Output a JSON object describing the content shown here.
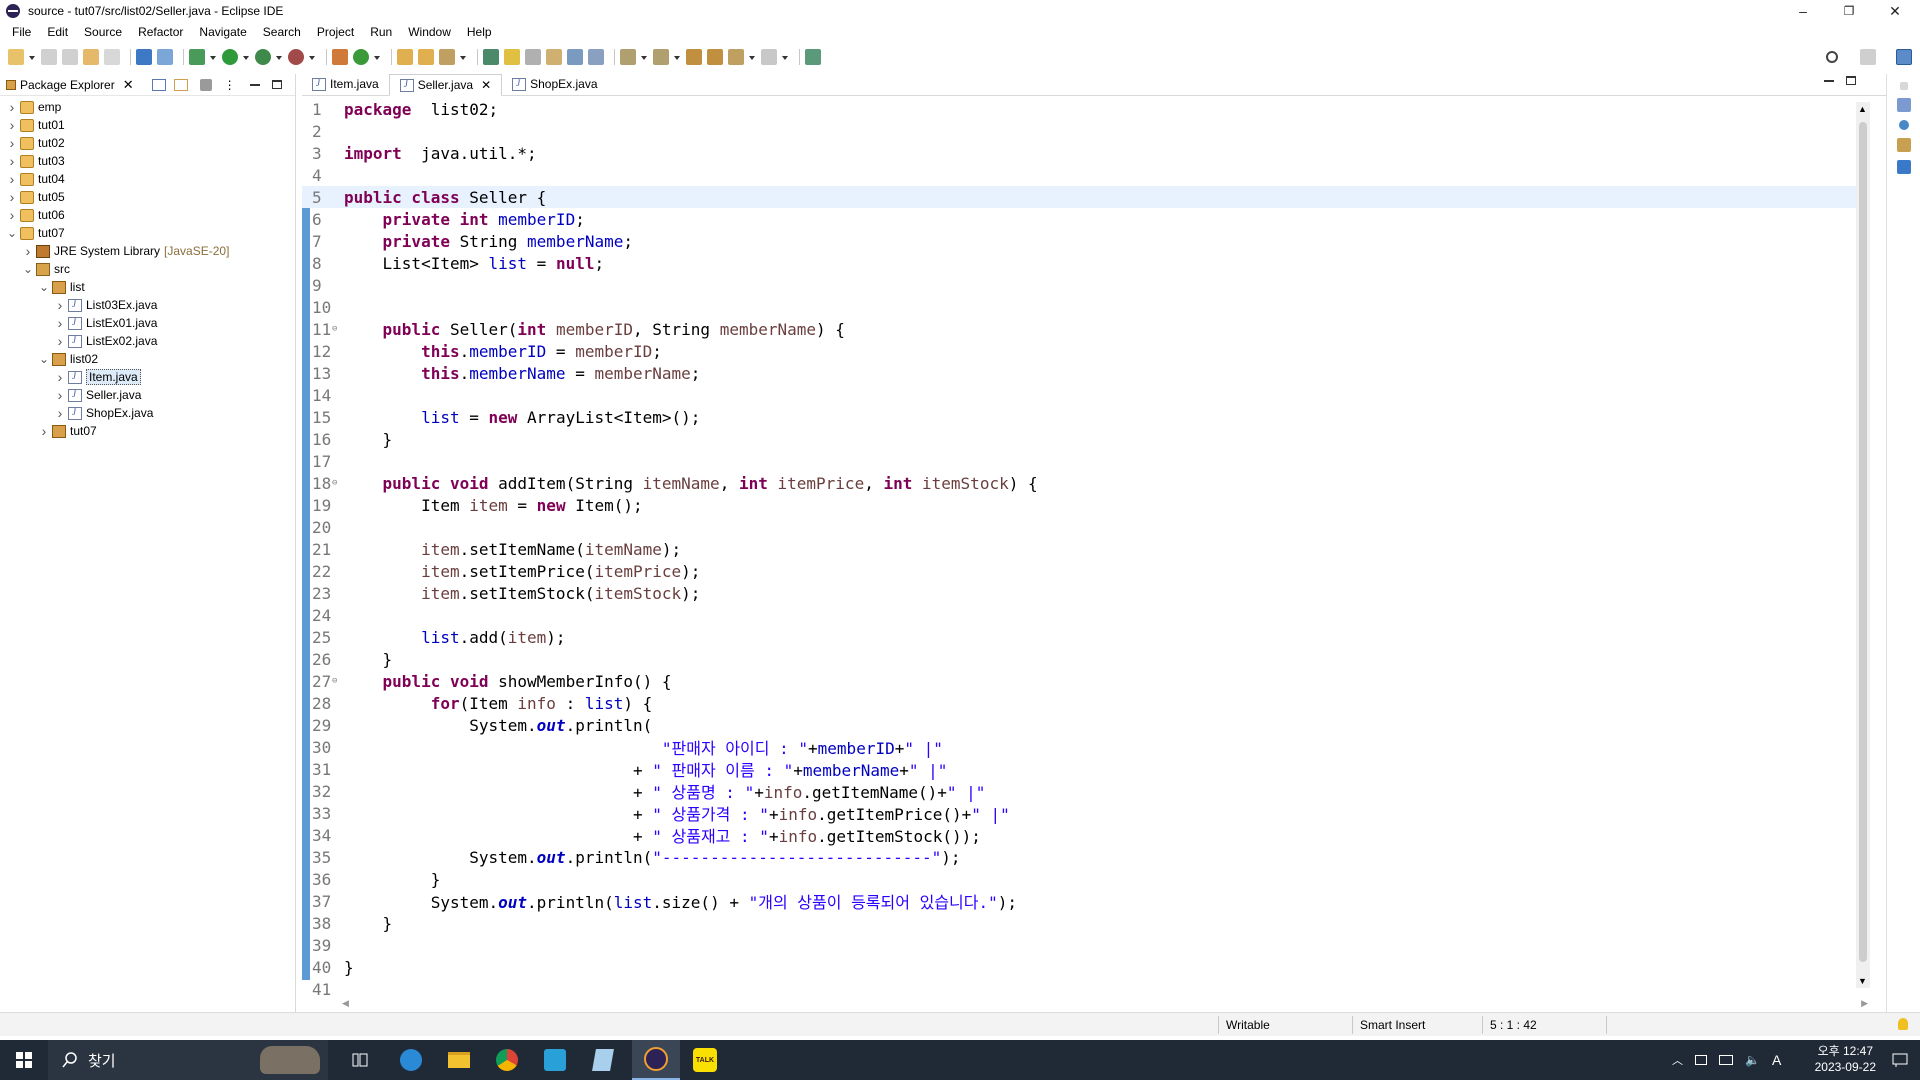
{
  "window": {
    "title": "source - tut07/src/list02/Seller.java - Eclipse IDE",
    "minimize": "–",
    "maximize": "❐",
    "close": "✕"
  },
  "menu": [
    "File",
    "Edit",
    "Source",
    "Refactor",
    "Navigate",
    "Search",
    "Project",
    "Run",
    "Window",
    "Help"
  ],
  "package_explorer": {
    "tab_label": "Package Explorer",
    "tree": [
      {
        "label": "emp",
        "depth": 0,
        "expanded": false,
        "icon": "project-icon"
      },
      {
        "label": "tut01",
        "depth": 0,
        "expanded": false,
        "icon": "project-icon"
      },
      {
        "label": "tut02",
        "depth": 0,
        "expanded": false,
        "icon": "project-icon"
      },
      {
        "label": "tut03",
        "depth": 0,
        "expanded": false,
        "icon": "project-icon"
      },
      {
        "label": "tut04",
        "depth": 0,
        "expanded": false,
        "icon": "project-icon"
      },
      {
        "label": "tut05",
        "depth": 0,
        "expanded": false,
        "icon": "project-icon"
      },
      {
        "label": "tut06",
        "depth": 0,
        "expanded": false,
        "icon": "project-icon"
      },
      {
        "label": "tut07",
        "depth": 0,
        "expanded": true,
        "icon": "project-icon"
      },
      {
        "label": "JRE System Library",
        "deco": "[JavaSE-20]",
        "depth": 1,
        "expanded": false,
        "icon": "library-icon"
      },
      {
        "label": "src",
        "depth": 1,
        "expanded": true,
        "icon": "source-folder-icon"
      },
      {
        "label": "list",
        "depth": 2,
        "expanded": true,
        "icon": "package-icon"
      },
      {
        "label": "List03Ex.java",
        "depth": 3,
        "expanded": false,
        "icon": "java-file-icon"
      },
      {
        "label": "ListEx01.java",
        "depth": 3,
        "expanded": false,
        "icon": "java-file-icon"
      },
      {
        "label": "ListEx02.java",
        "depth": 3,
        "expanded": false,
        "icon": "java-file-icon"
      },
      {
        "label": "list02",
        "depth": 2,
        "expanded": true,
        "icon": "package-icon"
      },
      {
        "label": "Item.java",
        "depth": 3,
        "expanded": false,
        "icon": "java-file-icon",
        "selected": true
      },
      {
        "label": "Seller.java",
        "depth": 3,
        "expanded": false,
        "icon": "java-file-icon"
      },
      {
        "label": "ShopEx.java",
        "depth": 3,
        "expanded": false,
        "icon": "java-file-icon"
      },
      {
        "label": "tut07",
        "depth": 2,
        "expanded": false,
        "icon": "package-icon"
      }
    ]
  },
  "editor": {
    "tabs": [
      {
        "label": "Item.java",
        "active": false
      },
      {
        "label": "Seller.java",
        "active": true
      },
      {
        "label": "ShopEx.java",
        "active": false
      }
    ],
    "current_line": 5,
    "lines": [
      [
        [
          "k",
          "package"
        ],
        [
          "",
          "  list02;"
        ]
      ],
      [],
      [
        [
          "k",
          "import"
        ],
        [
          "",
          "  java.util.*;"
        ]
      ],
      [],
      [
        [
          "k",
          "public class"
        ],
        [
          "",
          " Seller {"
        ]
      ],
      [
        [
          "",
          "    "
        ],
        [
          "k",
          "private int"
        ],
        [
          "",
          ""
        ],
        [
          "f",
          " memberID"
        ],
        [
          "",
          ";"
        ]
      ],
      [
        [
          "",
          "    "
        ],
        [
          "k",
          "private"
        ],
        [
          "",
          " String "
        ],
        [
          "f",
          "memberName"
        ],
        [
          "",
          ";"
        ]
      ],
      [
        [
          "",
          "    List<Item> "
        ],
        [
          "f",
          "list"
        ],
        [
          "",
          " = "
        ],
        [
          "k",
          "null"
        ],
        [
          "",
          ";"
        ]
      ],
      [],
      [],
      [
        [
          "",
          "    "
        ],
        [
          "k",
          "public"
        ],
        [
          "",
          " Seller("
        ],
        [
          "k",
          "int"
        ],
        [
          "",
          " "
        ],
        [
          "p",
          "memberID"
        ],
        [
          "",
          ", String "
        ],
        [
          "p",
          "memberName"
        ],
        [
          "",
          ") {"
        ]
      ],
      [
        [
          "",
          "        "
        ],
        [
          "k",
          "this"
        ],
        [
          "",
          "."
        ],
        [
          "f",
          "memberID"
        ],
        [
          "",
          " = "
        ],
        [
          "p",
          "memberID"
        ],
        [
          "",
          ";"
        ]
      ],
      [
        [
          "",
          "        "
        ],
        [
          "k",
          "this"
        ],
        [
          "",
          "."
        ],
        [
          "f",
          "memberName"
        ],
        [
          "",
          " = "
        ],
        [
          "p",
          "memberName"
        ],
        [
          "",
          ";"
        ]
      ],
      [],
      [
        [
          "",
          "        "
        ],
        [
          "f",
          "list"
        ],
        [
          "",
          " = "
        ],
        [
          "k",
          "new"
        ],
        [
          "",
          " ArrayList<Item>();"
        ]
      ],
      [
        [
          "",
          "    }"
        ]
      ],
      [],
      [
        [
          "",
          "    "
        ],
        [
          "k",
          "public void"
        ],
        [
          "",
          " addItem(String "
        ],
        [
          "p",
          "itemName"
        ],
        [
          "",
          ", "
        ],
        [
          "k",
          "int"
        ],
        [
          "",
          " "
        ],
        [
          "p",
          "itemPrice"
        ],
        [
          "",
          ", "
        ],
        [
          "k",
          "int"
        ],
        [
          "",
          " "
        ],
        [
          "p",
          "itemStock"
        ],
        [
          "",
          ") {"
        ]
      ],
      [
        [
          "",
          "        Item "
        ],
        [
          "p",
          "item"
        ],
        [
          "",
          " = "
        ],
        [
          "k",
          "new"
        ],
        [
          "",
          " Item();"
        ]
      ],
      [],
      [
        [
          "",
          "        "
        ],
        [
          "p",
          "item"
        ],
        [
          "",
          ".setItemName("
        ],
        [
          "p",
          "itemName"
        ],
        [
          "",
          ");"
        ]
      ],
      [
        [
          "",
          "        "
        ],
        [
          "p",
          "item"
        ],
        [
          "",
          ".setItemPrice("
        ],
        [
          "p",
          "itemPrice"
        ],
        [
          "",
          ");"
        ]
      ],
      [
        [
          "",
          "        "
        ],
        [
          "p",
          "item"
        ],
        [
          "",
          ".setItemStock("
        ],
        [
          "p",
          "itemStock"
        ],
        [
          "",
          ");"
        ]
      ],
      [],
      [
        [
          "",
          "        "
        ],
        [
          "f",
          "list"
        ],
        [
          "",
          ".add("
        ],
        [
          "p",
          "item"
        ],
        [
          "",
          ");"
        ]
      ],
      [
        [
          "",
          "    }"
        ]
      ],
      [
        [
          "",
          "    "
        ],
        [
          "k",
          "public void"
        ],
        [
          "",
          " showMemberInfo() {"
        ]
      ],
      [
        [
          "",
          "         "
        ],
        [
          "k",
          "for"
        ],
        [
          "",
          "(Item "
        ],
        [
          "p",
          "info"
        ],
        [
          "",
          " : "
        ],
        [
          "f",
          "list"
        ],
        [
          "",
          ") {"
        ]
      ],
      [
        [
          "",
          "             System."
        ],
        [
          "st",
          "out"
        ],
        [
          "",
          ".println("
        ]
      ],
      [
        [
          "",
          "                                 "
        ],
        [
          "s",
          "\"판매자 아이디 : \""
        ],
        [
          "",
          "+"
        ],
        [
          "f",
          "memberID"
        ],
        [
          "",
          "+"
        ],
        [
          "s",
          "\" |\""
        ]
      ],
      [
        [
          "",
          "                              + "
        ],
        [
          "s",
          "\" 판매자 이름 : \""
        ],
        [
          "",
          "+"
        ],
        [
          "f",
          "memberName"
        ],
        [
          "",
          "+"
        ],
        [
          "s",
          "\" |\""
        ]
      ],
      [
        [
          "",
          "                              + "
        ],
        [
          "s",
          "\" 상품명 : \""
        ],
        [
          "",
          "+"
        ],
        [
          "p",
          "info"
        ],
        [
          "",
          ".getItemName()+"
        ],
        [
          "s",
          "\" |\""
        ]
      ],
      [
        [
          "",
          "                              + "
        ],
        [
          "s",
          "\" 상품가격 : \""
        ],
        [
          "",
          "+"
        ],
        [
          "p",
          "info"
        ],
        [
          "",
          ".getItemPrice()+"
        ],
        [
          "s",
          "\" |\""
        ]
      ],
      [
        [
          "",
          "                              + "
        ],
        [
          "s",
          "\" 상품재고 : \""
        ],
        [
          "",
          "+"
        ],
        [
          "p",
          "info"
        ],
        [
          "",
          ".getItemStock());"
        ]
      ],
      [
        [
          "",
          "             System."
        ],
        [
          "st",
          "out"
        ],
        [
          "",
          ".println("
        ],
        [
          "s",
          "\"----------------------------\""
        ],
        [
          "",
          ");"
        ]
      ],
      [
        [
          "",
          "         }"
        ]
      ],
      [
        [
          "",
          "         System."
        ],
        [
          "st",
          "out"
        ],
        [
          "",
          ".println("
        ],
        [
          "f",
          "list"
        ],
        [
          "",
          ".size() + "
        ],
        [
          "s",
          "\"개의 상품이 등록되어 있습니다.\""
        ],
        [
          "",
          ");"
        ]
      ],
      [
        [
          "",
          "    }"
        ]
      ],
      [],
      [
        [
          "",
          "}"
        ]
      ],
      []
    ],
    "fold_lines": [
      11,
      18,
      27
    ]
  },
  "status": {
    "writable": "Writable",
    "insert_mode": "Smart Insert",
    "position": "5 : 1 : 42"
  },
  "taskbar": {
    "search_placeholder": "찾기",
    "tray_lang": "A",
    "clock_period_time": "오후 12:47",
    "clock_date": "2023-09-22"
  },
  "colors": {
    "keyword": "#7f0055",
    "field": "#0000c0",
    "string": "#2a00ff",
    "param": "#6a3e3e",
    "ruler": "#5e9ad6",
    "taskbar": "#202a36"
  }
}
